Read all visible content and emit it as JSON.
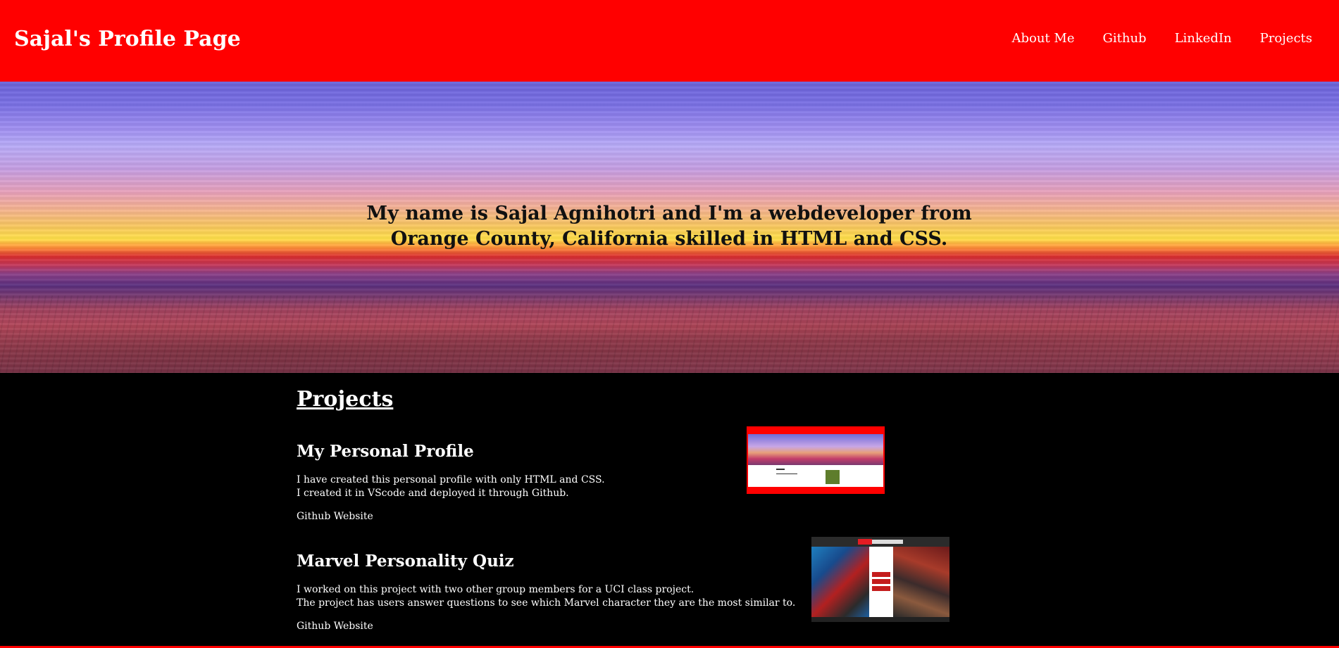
{
  "header": {
    "title": "Sajal's Profile Page",
    "nav": [
      "About Me",
      "Github",
      "LinkedIn",
      "Projects"
    ]
  },
  "hero": {
    "text": "My name is Sajal Agnihotri and I'm a webdeveloper from Orange County, California skilled in HTML and CSS."
  },
  "projects": {
    "title": "Projects",
    "items": [
      {
        "name": "My Personal Profile",
        "desc_line1": "I have created this personal profile with only HTML and CSS.",
        "desc_line2": "I created it in VScode and deployed it through Github.",
        "link": "Github Website"
      },
      {
        "name": "Marvel Personality Quiz",
        "desc_line1": "I worked on this project with two other group members for a UCI class project.",
        "desc_line2": "The project has users answer questions to see which Marvel character they are the most similar to.",
        "link": "Github Website"
      }
    ]
  },
  "colors": {
    "header_bg": "#ff0000",
    "page_bg": "#000000",
    "text": "#ffffff"
  }
}
